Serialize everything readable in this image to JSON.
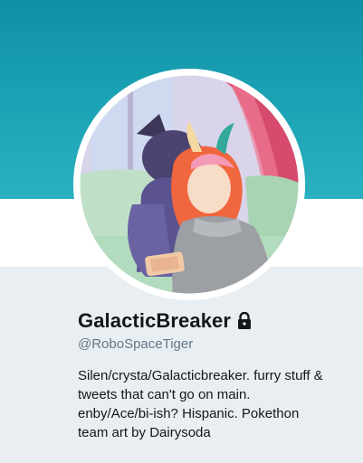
{
  "profile": {
    "display_name": "GalacticBreaker",
    "handle": "@RoboSpaceTiger",
    "protected_icon": "lock-icon",
    "bio_lines": [
      "Silen/crysta/Galacticbreaker. furry stuff &",
      "tweets that can't go on main.",
      "enby/Ace/bi-ish? Hispanic. Pokethon",
      "team art by Dairysoda"
    ]
  },
  "colors": {
    "banner": "#1aa0b3",
    "page_background": "#e9eef2",
    "text_primary": "#14171a",
    "text_secondary": "#657786"
  }
}
